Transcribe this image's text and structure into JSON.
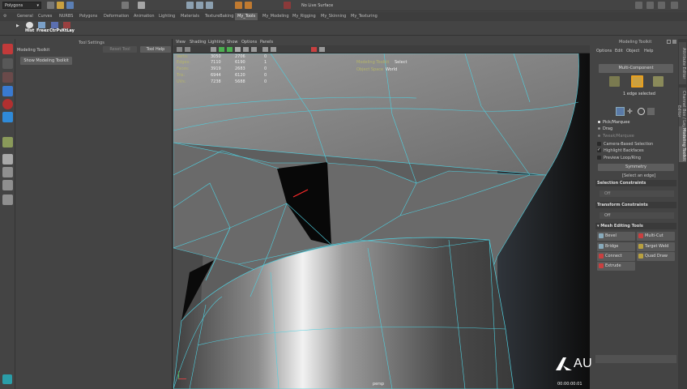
{
  "status_line": {
    "mode": "Polygons",
    "live_surface": "No Live Surface"
  },
  "shelf_tabs": [
    "General",
    "Curves",
    "NURBS",
    "Polygons",
    "Deformation",
    "Animation",
    "Lighting",
    "Materials",
    "TextureBaking",
    "My_Tools",
    "My_Modeling",
    "My_Rigging",
    "My_Skinning",
    "My_Texturing"
  ],
  "active_shelf_tab": "My_Tools",
  "shelf_buttons": [
    "Hist",
    "Freez",
    "CtrPv",
    "XtLay"
  ],
  "tool_settings": {
    "title": "Tool Settings",
    "tool_name": "Modeling Toolkit",
    "reset_label": "Reset Tool",
    "help_label": "Tool Help",
    "show_button": "Show Modeling Toolkit"
  },
  "viewport": {
    "menus": [
      "View",
      "Shading",
      "Lighting",
      "Show",
      "Options",
      "Panels"
    ],
    "hud_stats": [
      [
        "3050",
        "2706",
        "0"
      ],
      [
        "7110",
        "6190",
        "1"
      ],
      [
        "3919",
        "2683",
        "0"
      ],
      [
        "6944",
        "6120",
        "0"
      ],
      [
        "7238",
        "5688",
        "0"
      ]
    ],
    "hud_right": [
      {
        "label": "Modeling Toolkit",
        "value": "Select"
      },
      {
        "label": "Object Space",
        "value": "World"
      }
    ],
    "camera": "persp",
    "timecode": "00:00:00:01",
    "watermark": "AUTODESK"
  },
  "modeling_toolkit": {
    "title": "Modeling Toolkit",
    "menus": [
      "Options",
      "Edit",
      "Object",
      "Help"
    ],
    "multi_component": "Multi-Component",
    "selection_info": "1 edge selected",
    "pick_options": [
      "Pick/Marquee",
      "Drag",
      "Tweak/Marquee"
    ],
    "checks": [
      {
        "label": "Camera-Based Selection",
        "checked": false
      },
      {
        "label": "Highlight Backfaces",
        "checked": true
      },
      {
        "label": "Preview Loop/Ring",
        "checked": false
      }
    ],
    "symmetry": "Symmetry",
    "select_hint": "[Select an edge]",
    "selection_constraints": "Selection Constraints",
    "constraint_value": "Off",
    "transform_constraints": "Transform Constraints",
    "transform_value": "Off",
    "mesh_editing": "Mesh Editing Tools",
    "tools": [
      [
        "Bevel",
        "Multi-Cut"
      ],
      [
        "Bridge",
        "Target Weld"
      ],
      [
        "Connect",
        "Quad Draw"
      ],
      [
        "Extrude"
      ]
    ]
  },
  "side_tabs": [
    "Attribute Editor",
    "Channel Box / Layer Editor",
    "Modeling Toolkit"
  ],
  "colors": {
    "wire": "#4fd0e0",
    "selected_edge": "#ff2a2a",
    "accent": "#e8a020"
  }
}
